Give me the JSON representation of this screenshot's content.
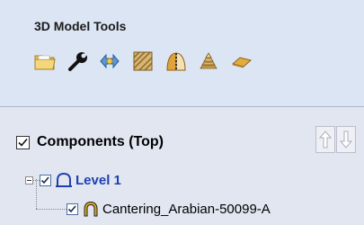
{
  "tools_panel": {
    "title": "3D Model Tools",
    "icons": [
      "open-folder-icon",
      "wrench-icon",
      "move-arrows-icon",
      "texture-icon",
      "split-dome-icon",
      "stacked-layers-icon",
      "flat-plate-icon"
    ]
  },
  "components_panel": {
    "title": "Components (Top)",
    "header_checked": true,
    "move_up_icon": "arrow-up-icon",
    "move_down_icon": "arrow-down-icon",
    "tree": {
      "level": {
        "label": "Level 1",
        "checked": true,
        "expanded": true
      },
      "children": [
        {
          "label": "Cantering_Arabian-50099-A",
          "checked": true
        }
      ]
    }
  },
  "colors": {
    "level_label": "#1f3fb0",
    "panel_background": "#dce5f4",
    "component_icon": "#d9a52b"
  }
}
